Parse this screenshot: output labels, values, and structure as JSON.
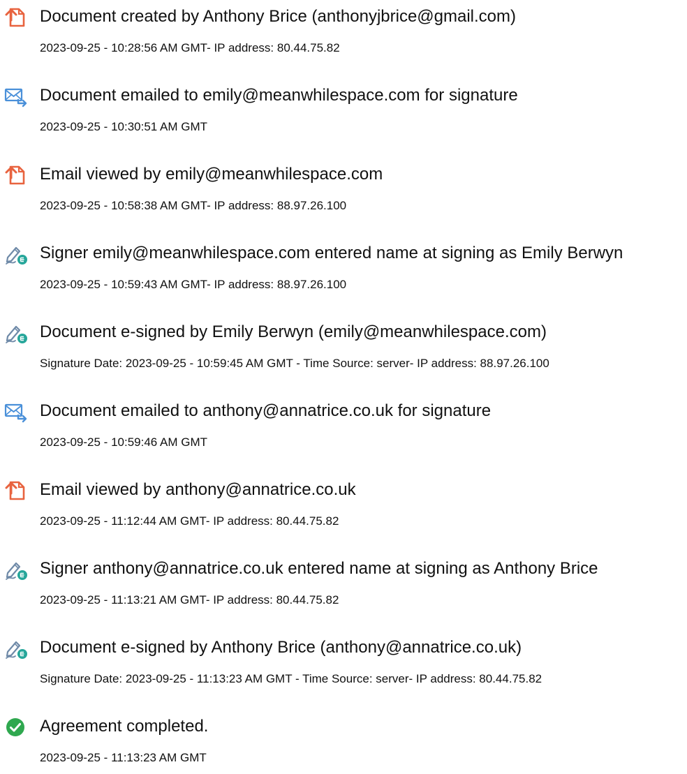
{
  "entries": [
    {
      "icon": "document-created-icon",
      "title": "Document created by Anthony Brice (anthonyjbrice@gmail.com)",
      "meta": "2023-09-25 - 10:28:56 AM GMT- IP address: 80.44.75.82"
    },
    {
      "icon": "email-sent-icon",
      "title": "Document emailed to emily@meanwhilespace.com for signature",
      "meta": "2023-09-25 - 10:30:51 AM GMT"
    },
    {
      "icon": "document-viewed-icon",
      "title": "Email viewed by emily@meanwhilespace.com",
      "meta": "2023-09-25 - 10:58:38 AM GMT- IP address: 88.97.26.100"
    },
    {
      "icon": "signer-pen-icon",
      "title": "Signer emily@meanwhilespace.com entered name at signing as Emily Berwyn",
      "meta": "2023-09-25 - 10:59:43 AM GMT- IP address: 88.97.26.100"
    },
    {
      "icon": "esign-pen-icon",
      "title": "Document e-signed by Emily Berwyn (emily@meanwhilespace.com)",
      "meta": "Signature Date: 2023-09-25 - 10:59:45 AM GMT - Time Source: server- IP address: 88.97.26.100"
    },
    {
      "icon": "email-sent-icon",
      "title": "Document emailed to anthony@annatrice.co.uk for signature",
      "meta": "2023-09-25 - 10:59:46 AM GMT"
    },
    {
      "icon": "document-viewed-icon",
      "title": "Email viewed by anthony@annatrice.co.uk",
      "meta": "2023-09-25 - 11:12:44 AM GMT- IP address: 80.44.75.82"
    },
    {
      "icon": "signer-pen-icon",
      "title": "Signer anthony@annatrice.co.uk entered name at signing as Anthony Brice",
      "meta": "2023-09-25 - 11:13:21 AM GMT- IP address: 80.44.75.82"
    },
    {
      "icon": "esign-pen-icon",
      "title": "Document e-signed by Anthony Brice (anthony@annatrice.co.uk)",
      "meta": "Signature Date: 2023-09-25 - 11:13:23 AM GMT - Time Source: server- IP address: 80.44.75.82"
    },
    {
      "icon": "agreement-completed-icon",
      "title": "Agreement completed.",
      "meta": "2023-09-25 - 11:13:23 AM GMT"
    }
  ],
  "colors": {
    "document_icon": "#E8633F",
    "email_icon": "#4A90D9",
    "pen_icon": "#6F8AA8",
    "esign_badge": "#26A69A",
    "completed_icon": "#2FA84F"
  }
}
